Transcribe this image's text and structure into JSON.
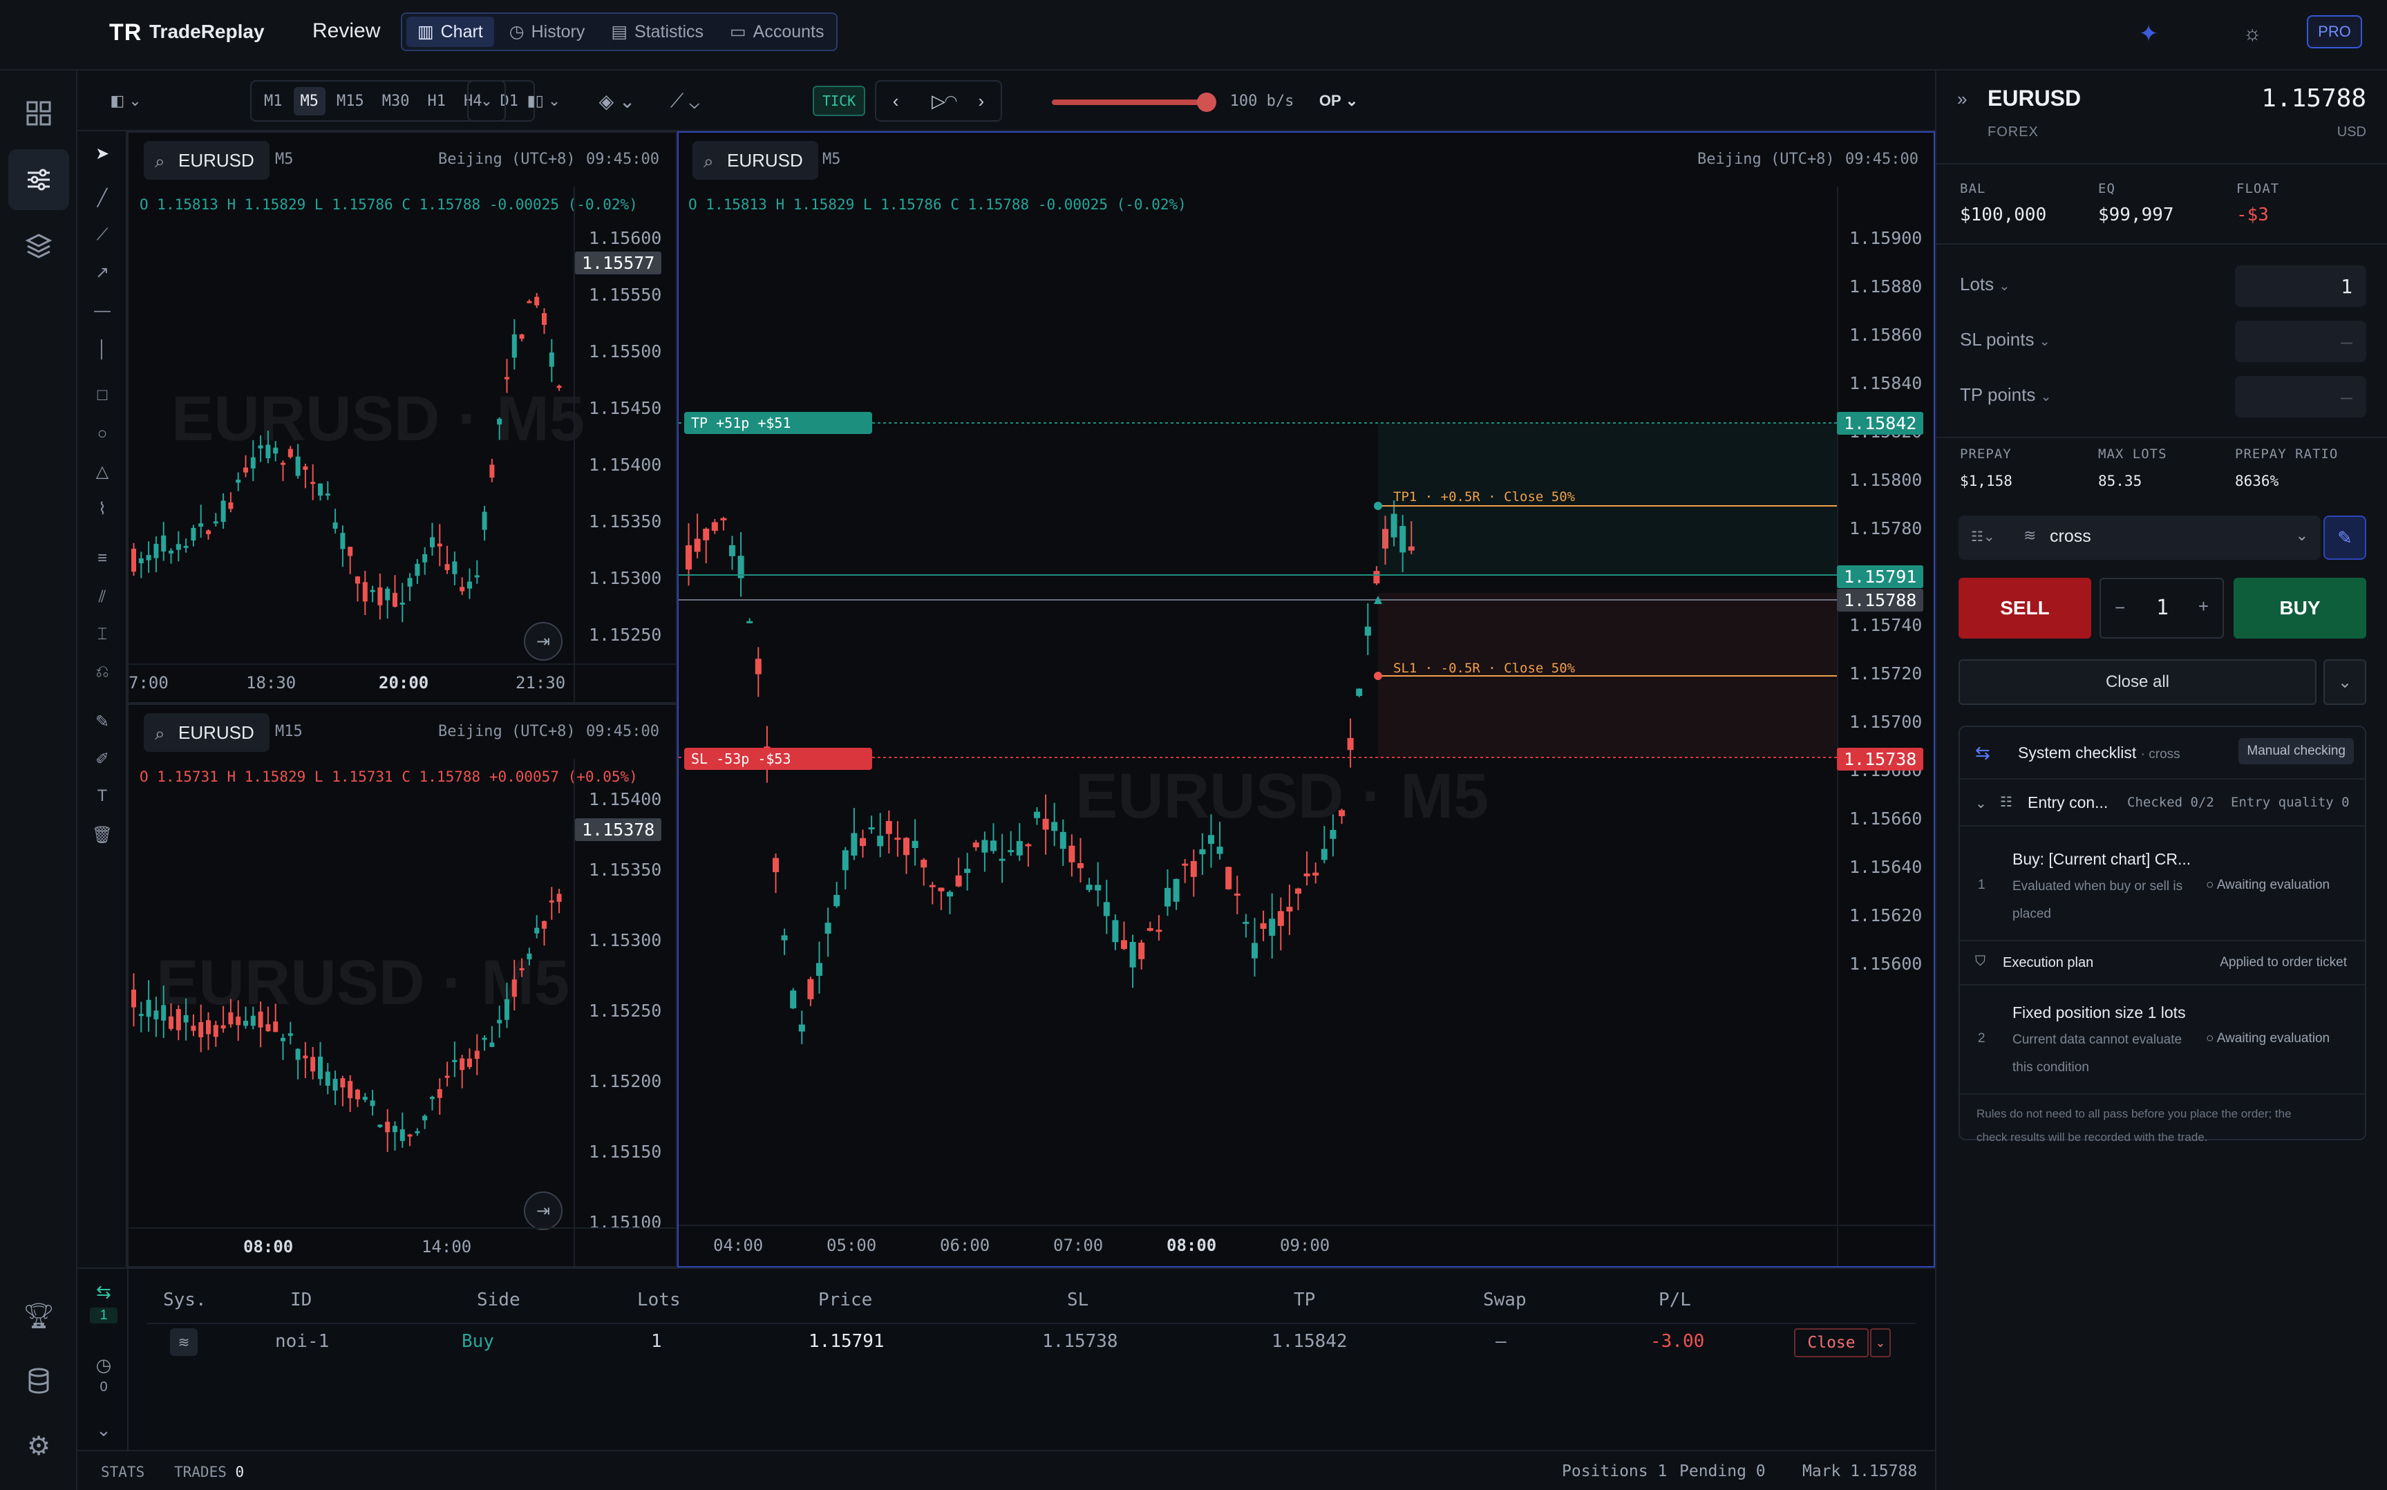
{
  "app": {
    "logo": "TR",
    "name": "TradeReplay",
    "section": "Review"
  },
  "nav": [
    {
      "label": "Chart",
      "icon": "chart-icon",
      "active": true
    },
    {
      "label": "History",
      "icon": "history-icon",
      "active": false
    },
    {
      "label": "Statistics",
      "icon": "statistics-icon",
      "active": false
    },
    {
      "label": "Accounts",
      "icon": "accounts-icon",
      "active": false
    }
  ],
  "pro": "PRO",
  "toolbar": {
    "timeframes": [
      "M1",
      "M5",
      "M15",
      "M30",
      "H1",
      "H4",
      "D1"
    ],
    "active_tf": "M5",
    "tick": "TICK",
    "speed": "100 b/s",
    "speed_fraction": 0.95,
    "mode": "OP"
  },
  "panes": {
    "top_left": {
      "symbol": "EURUSD",
      "tf": "M5",
      "tz": "Beijing (UTC+8)",
      "time": "09:45:00",
      "ohlc": {
        "o": "1.15813",
        "h": "1.15829",
        "l": "1.15786",
        "c": "1.15788",
        "chg": "-0.00025 (-0.02%)"
      },
      "watermark": "EURUSD · M5",
      "yticks": [
        "1.15600",
        "1.15550",
        "1.15500",
        "1.15450",
        "1.15400",
        "1.15350",
        "1.15300",
        "1.15250"
      ],
      "price_tag": "1.15577",
      "xticks": [
        "7:00",
        "18:30",
        "20:00",
        "21:30"
      ]
    },
    "bottom_left": {
      "symbol": "EURUSD",
      "tf": "M15",
      "tz": "Beijing (UTC+8)",
      "time": "09:45:00",
      "ohlc": {
        "o": "1.15731",
        "h": "1.15829",
        "l": "1.15731",
        "c": "1.15788",
        "chg": "+0.00057 (+0.05%)"
      },
      "watermark": "EURUSD · M5",
      "yticks": [
        "1.15400",
        "1.15350",
        "1.15300",
        "1.15250",
        "1.15200",
        "1.15150",
        "1.15100"
      ],
      "price_tag": "1.15378",
      "xticks": [
        "08:00",
        "14:00"
      ]
    },
    "main": {
      "symbol": "EURUSD",
      "tf": "M5",
      "tz": "Beijing (UTC+8)",
      "time": "09:45:00",
      "ohlc": {
        "o": "1.15813",
        "h": "1.15829",
        "l": "1.15786",
        "c": "1.15788",
        "chg": "-0.00025 (-0.02%)"
      },
      "watermark": "EURUSD · M5",
      "yticks": [
        "1.15900",
        "1.15880",
        "1.15860",
        "1.15840",
        "1.15820",
        "1.15800",
        "1.15780",
        "1.15760",
        "1.15740",
        "1.15720",
        "1.15700",
        "1.15680",
        "1.15660",
        "1.15640",
        "1.15620",
        "1.15600"
      ],
      "xticks": [
        "04:00",
        "05:00",
        "06:00",
        "07:00",
        "08:00",
        "09:00"
      ],
      "tp_label": "TP +51p +$51",
      "sl_label": "SL -53p -$53",
      "tp1_label": "TP1 · +0.5R · Close 50%",
      "sl1_label": "SL1 · -0.5R · Close 50%",
      "tags": {
        "tp": "1.15842",
        "entry": "1.15791",
        "mark": "1.15788",
        "sl": "1.15738"
      }
    }
  },
  "positions": {
    "headers": [
      "Sys.",
      "ID",
      "Side",
      "Lots",
      "Price",
      "SL",
      "TP",
      "Swap",
      "P/L"
    ],
    "rows": [
      {
        "id": "noi-1",
        "side": "Buy",
        "lots": "1",
        "price": "1.15791",
        "sl": "1.15738",
        "tp": "1.15842",
        "swap": "—",
        "pl": "-3.00",
        "close": "Close"
      }
    ],
    "open_count": "1",
    "history_count": "0"
  },
  "status": {
    "stats": "STATS",
    "trades_label": "TRADES",
    "trades": "0",
    "positions": "Positions 1",
    "pending": "Pending 0",
    "mark": "Mark 1.15788"
  },
  "ticket": {
    "symbol": "EURUSD",
    "category": "FOREX",
    "price": "1.15788",
    "ccy": "USD",
    "bal_label": "BAL",
    "bal": "$100,000",
    "eq_label": "EQ",
    "eq": "$99,997",
    "float_label": "FLOAT",
    "float": "-$3",
    "lots_label": "Lots",
    "lots": "1",
    "sl_label": "SL points",
    "sl_val": "—",
    "tp_label": "TP points",
    "tp_val": "—",
    "prepay_label": "PREPAY",
    "prepay": "$1,158",
    "maxlots_label": "MAX LOTS",
    "maxlots": "85.35",
    "ratio_label": "PREPAY RATIO",
    "ratio": "8636%",
    "mode": "cross",
    "sell": "SELL",
    "buy": "BUY",
    "qty": "1",
    "close_all": "Close all"
  },
  "checklist": {
    "title": "System checklist",
    "mode": "· cross",
    "manual": "Manual checking",
    "entry": "Entry con...",
    "checked": "Checked 0/2",
    "quality": "Entry quality 0",
    "rule1": {
      "num": "1",
      "title": "Buy: [Current chart] CR...",
      "desc1": "Evaluated when buy or sell is",
      "desc2": "placed",
      "status": "Awaiting evaluation"
    },
    "exec": "Execution plan",
    "applied": "Applied to order ticket",
    "rule2": {
      "num": "2",
      "title": "Fixed position size 1 lots",
      "desc1": "Current data cannot evaluate",
      "desc2": "this condition",
      "status": "Awaiting evaluation"
    },
    "note1": "Rules do not need to all pass before you place the order; the",
    "note2": "check results will be recorded with the trade."
  },
  "colors": {
    "up": "#26a69a",
    "down": "#ef5350",
    "accent": "#3557d6",
    "tp": "#1d8f7f",
    "sl": "#d9363e"
  }
}
